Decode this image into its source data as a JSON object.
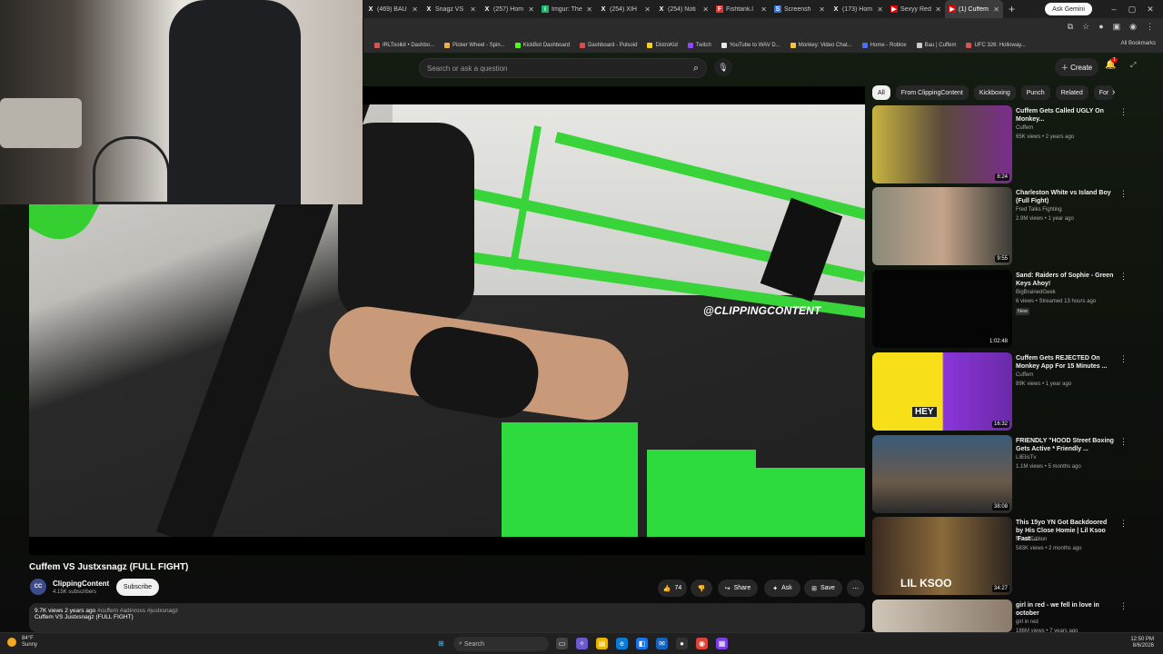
{
  "browser": {
    "tabs": [
      {
        "label": "(469) BAU",
        "icon": "x-logo-icon"
      },
      {
        "label": "Snagz VS",
        "icon": "x-logo-icon"
      },
      {
        "label": "(257) Hom",
        "icon": "x-logo-icon"
      },
      {
        "label": "Imgur: The",
        "icon": "imgur-icon"
      },
      {
        "label": "(254) XIH",
        "icon": "x-logo-icon"
      },
      {
        "label": "(254) Noti",
        "icon": "x-logo-icon"
      },
      {
        "label": "Fishtank.l",
        "icon": "fishtank-icon"
      },
      {
        "label": "Screensh",
        "icon": "screenshot-icon"
      },
      {
        "label": "(173) Hom",
        "icon": "x-logo-icon"
      },
      {
        "label": "Sexyy Red",
        "icon": "youtube-icon"
      },
      {
        "label": "(1) Cuffem",
        "icon": "youtube-icon",
        "active": true
      }
    ],
    "gemini_label": "Ask Gemini",
    "bookmarks": [
      {
        "label": "IRLToolkit • Dashbo...",
        "color": "#d9534f"
      },
      {
        "label": "Picker Wheel - Spin...",
        "color": "#f0ad4e"
      },
      {
        "label": "KickBot Dashboard",
        "color": "#53fc18"
      },
      {
        "label": "Dashboard - Pulsoid",
        "color": "#e24a4a"
      },
      {
        "label": "DistroKid",
        "color": "#f7d117"
      },
      {
        "label": "Twitch",
        "color": "#9146ff"
      },
      {
        "label": "YouTube to WAV D...",
        "color": "#e8e8e8"
      },
      {
        "label": "Monkey: Video Chat...",
        "color": "#f6c343"
      },
      {
        "label": "Home - Roblox",
        "color": "#4c6ef5"
      },
      {
        "label": "Bau | Cuffem",
        "color": "#cccccc"
      },
      {
        "label": "UFC 326: Holloway...",
        "color": "#d9534f"
      }
    ],
    "all_bookmarks": "All Bookmarks"
  },
  "youtube": {
    "search_placeholder": "Search or ask a question",
    "create_label": "Create",
    "notification_count": "1",
    "watermark": "@CLIPPINGCONTENT",
    "video_title": "Cuffem VS Justxsnagz (FULL FIGHT)",
    "channel": {
      "name": "ClippingContent",
      "subscribers": "4.15K subscribers",
      "avatar_text": "CC"
    },
    "subscribe_label": "Subscribe",
    "likes": "74",
    "share_label": "Share",
    "ask_label": "Ask",
    "save_label": "Save",
    "description": {
      "views_date": "9.7K views  2 years ago",
      "tags": "#cuffem #adinross #justxsnagz",
      "text": "Cuffem VS Justxsnagz (FULL FIGHT)"
    },
    "chips": [
      "All",
      "From ClippingContent",
      "Kickboxing",
      "Punch",
      "Related",
      "For"
    ],
    "recommendations": [
      {
        "title": "Cuffem Gets Called UGLY On Monkey...",
        "channel": "Cuffem",
        "meta": "65K views • 2 years ago",
        "duration": "8:24"
      },
      {
        "title": "Charleston White vs Island Boy (Full Fight)",
        "channel": "Fred Talks Fighting",
        "meta": "2.9M views • 1 year ago",
        "duration": "9:55"
      },
      {
        "title": "Sand: Raiders of Sophie - Green Keys Ahoy!",
        "channel": "BigBrainedGeek",
        "meta": "6 views • Streamed 13 hours ago",
        "badge": "New",
        "duration": "1:02:48"
      },
      {
        "title": "Cuffem Gets REJECTED On Monkey App For 15 Minutes ...",
        "channel": "Cuffem",
        "meta": "89K views • 1 year ago",
        "duration": "16:32",
        "thumb_text": "HEY"
      },
      {
        "title": "FRIENDLY \"HOOD Street Boxing Gets Active * Friendly ...",
        "channel": "LilElisTv",
        "meta": "1.1M views • 5 months ago",
        "duration": "38:08"
      },
      {
        "title": "This 15yo YN Got Backdoored by His Close Homie | Lil Ksoo 'Fast ...",
        "channel": "Hood Edition",
        "meta": "583K views • 2 months ago",
        "duration": "34:27",
        "thumb_text": "LIL KSOO"
      },
      {
        "title": "girl in red - we fell in love in october",
        "channel": "girl in red",
        "meta": "186M views • 7 years ago",
        "duration": ""
      }
    ]
  },
  "taskbar": {
    "temperature": "84°F",
    "weather": "Sunny",
    "search_placeholder": "Search",
    "time": "12:50 PM",
    "date": "8/6/2026"
  }
}
